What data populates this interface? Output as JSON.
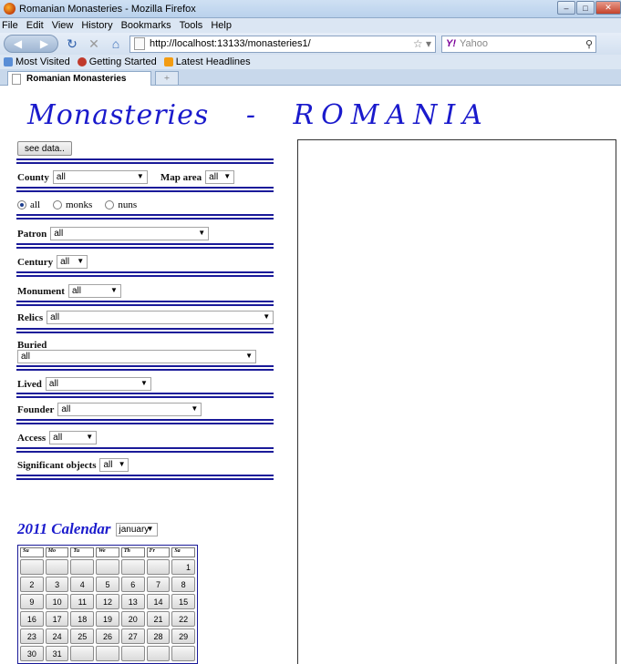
{
  "window": {
    "title": "Romanian Monasteries - Mozilla Firefox"
  },
  "menu": [
    "File",
    "Edit",
    "View",
    "History",
    "Bookmarks",
    "Tools",
    "Help"
  ],
  "nav": {
    "url": "http://localhost:13133/monasteries1/",
    "search_placeholder": "Yahoo",
    "search_engine": "Y!"
  },
  "bookmarks": [
    "Most Visited",
    "Getting Started",
    "Latest Headlines"
  ],
  "tab": {
    "title": "Romanian Monasteries",
    "new_tab": "+"
  },
  "header": {
    "part1": "Monasteries",
    "dash": "-",
    "part2": "ROMANIA"
  },
  "see_data_label": "see data..",
  "filters": {
    "county": {
      "label": "County",
      "value": "all"
    },
    "map_area": {
      "label": "Map area",
      "value": "all"
    },
    "radio": {
      "options": [
        "all",
        "monks",
        "nuns"
      ],
      "selected": "all"
    },
    "patron": {
      "label": "Patron",
      "value": "all"
    },
    "century": {
      "label": "Century",
      "value": "all"
    },
    "monument": {
      "label": "Monument",
      "value": "all"
    },
    "relics": {
      "label": "Relics",
      "value": "all"
    },
    "buried": {
      "label": "Buried",
      "value": "all"
    },
    "lived": {
      "label": "Lived",
      "value": "all"
    },
    "founder": {
      "label": "Founder",
      "value": "all"
    },
    "access": {
      "label": "Access",
      "value": "all"
    },
    "significant": {
      "label": "Significant objects",
      "value": "all"
    }
  },
  "calendar": {
    "title": "2011 Calendar",
    "month": "january",
    "weekdays": [
      "Su",
      "Mo",
      "Tu",
      "We",
      "Th",
      "Fr",
      "Sa"
    ],
    "weeks": [
      [
        "",
        "",
        "",
        "",
        "",
        "",
        "1"
      ],
      [
        "2",
        "3",
        "4",
        "5",
        "6",
        "7",
        "8"
      ],
      [
        "9",
        "10",
        "11",
        "12",
        "13",
        "14",
        "15"
      ],
      [
        "16",
        "17",
        "18",
        "19",
        "20",
        "21",
        "22"
      ],
      [
        "23",
        "24",
        "25",
        "26",
        "27",
        "28",
        "29"
      ],
      [
        "30",
        "31",
        "",
        "",
        "",
        "",
        ""
      ]
    ]
  },
  "colors": {
    "accent": "#1a1acc",
    "rule": "#1a1a99"
  }
}
